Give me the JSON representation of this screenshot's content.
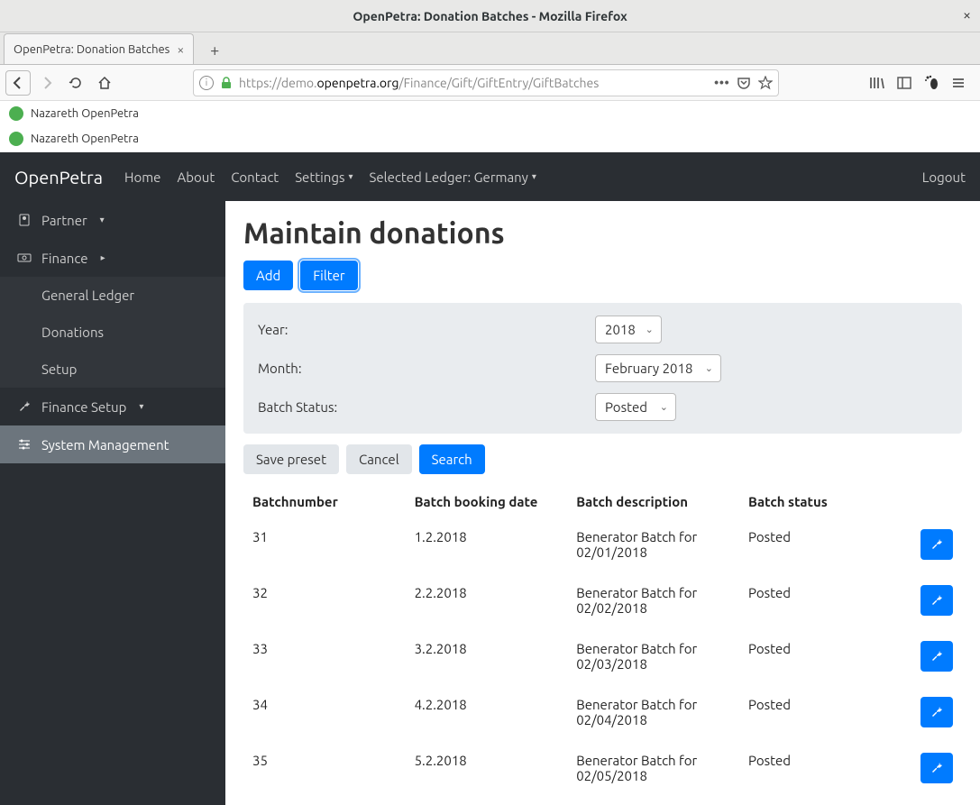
{
  "window": {
    "title": "OpenPetra: Donation Batches - Mozilla Firefox"
  },
  "tab": {
    "title": "OpenPetra: Donation Batches"
  },
  "url": {
    "prefix": "https://demo.",
    "domain": "openpetra.org",
    "path": "/Finance/Gift/GiftEntry/GiftBatches"
  },
  "bookmarks": [
    {
      "label": "Nazareth OpenPetra"
    },
    {
      "label": "Nazareth OpenPetra"
    }
  ],
  "navbar": {
    "brand": "OpenPetra",
    "home": "Home",
    "about": "About",
    "contact": "Contact",
    "settings": "Settings",
    "ledger": "Selected Ledger: Germany",
    "logout": "Logout"
  },
  "sidebar": {
    "partner": "Partner",
    "finance": "Finance",
    "general_ledger": "General Ledger",
    "donations": "Donations",
    "setup": "Setup",
    "finance_setup": "Finance Setup",
    "system_mgmt": "System Management"
  },
  "page": {
    "title": "Maintain donations"
  },
  "buttons": {
    "add": "Add",
    "filter": "Filter",
    "save_preset": "Save preset",
    "cancel": "Cancel",
    "search": "Search"
  },
  "filter": {
    "year_label": "Year:",
    "year_value": "2018",
    "month_label": "Month:",
    "month_value": "February 2018",
    "status_label": "Batch Status:",
    "status_value": "Posted"
  },
  "table": {
    "headers": {
      "number": "Batchnumber",
      "date": "Batch booking date",
      "desc": "Batch description",
      "status": "Batch status"
    },
    "rows": [
      {
        "number": "31",
        "date": "1.2.2018",
        "desc": "Benerator Batch for 02/01/2018",
        "status": "Posted"
      },
      {
        "number": "32",
        "date": "2.2.2018",
        "desc": "Benerator Batch for 02/02/2018",
        "status": "Posted"
      },
      {
        "number": "33",
        "date": "3.2.2018",
        "desc": "Benerator Batch for 02/03/2018",
        "status": "Posted"
      },
      {
        "number": "34",
        "date": "4.2.2018",
        "desc": "Benerator Batch for 02/04/2018",
        "status": "Posted"
      },
      {
        "number": "35",
        "date": "5.2.2018",
        "desc": "Benerator Batch for 02/05/2018",
        "status": "Posted"
      }
    ]
  }
}
